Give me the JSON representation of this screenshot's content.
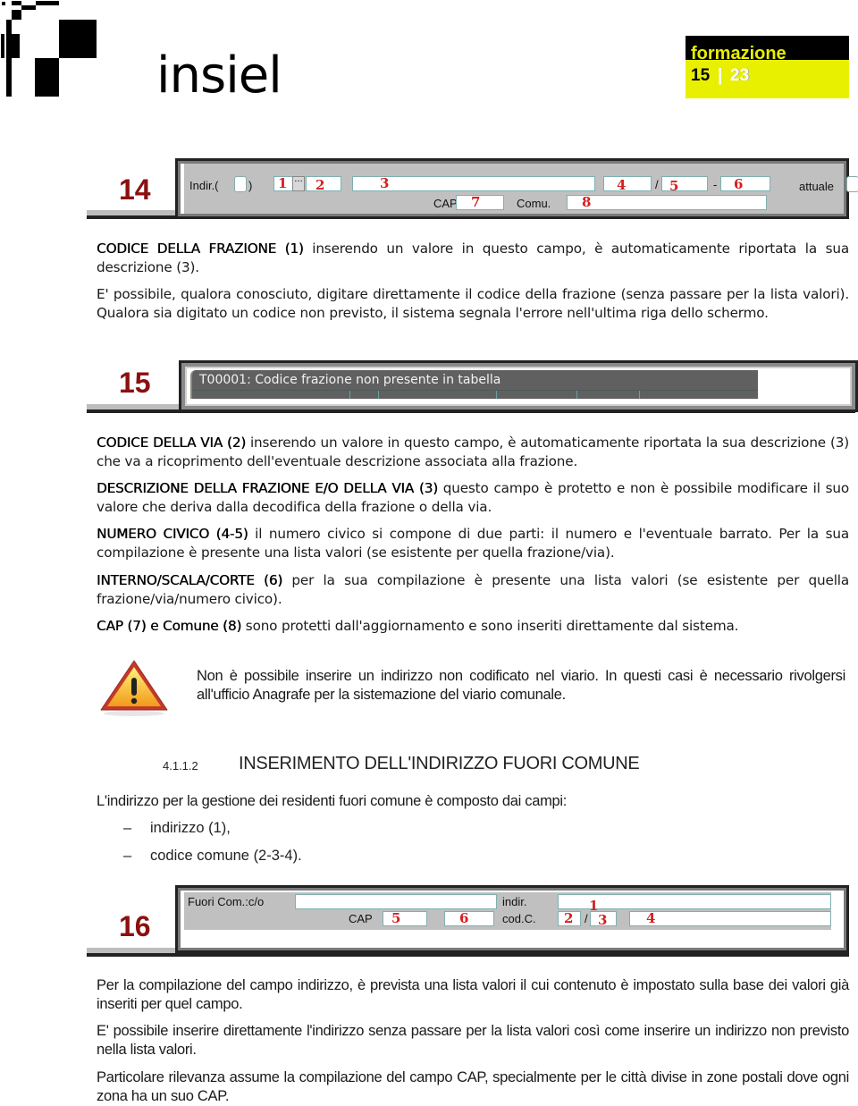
{
  "header": {
    "brand": "insiel",
    "badge_label": "formazione",
    "page_current": "15",
    "page_separator": "|",
    "page_total": "23",
    "colors": {
      "badge_yellow": "#e8f000",
      "figure_number": "#8b1010",
      "field_number": "#d42020"
    }
  },
  "figure14": {
    "number": "14",
    "labels": {
      "indir": "Indir.(",
      "close_paren": ")",
      "ellipsis": "···",
      "slash": "/",
      "dash": "-",
      "attuale": "attuale",
      "cap": "CAP",
      "comu": "Comu."
    },
    "field_numbers": [
      "1",
      "2",
      "3",
      "4",
      "5",
      "6",
      "7",
      "8"
    ]
  },
  "paragraphs_a": {
    "p1_bold": "CODICE DELLA FRAZIONE (1)",
    "p1_text": " inserendo un valore in questo campo, è automaticamente riportata la sua descrizione (3).",
    "p2_text": "E' possibile, qualora conosciuto, digitare direttamente il codice della frazione (senza passare per la lista valori). Qualora sia digitato un codice non previsto, il sistema segnala l'errore nell'ultima riga dello schermo."
  },
  "figure15": {
    "number": "15",
    "error_message": "T00001: Codice frazione non presente in tabella"
  },
  "paragraphs_b": [
    {
      "bold": "CODICE DELLA VIA (2)",
      "text": " inserendo un valore in questo campo, è automaticamente riportata la sua descrizione (3) che va a ricoprimento dell'eventuale descrizione associata alla frazione."
    },
    {
      "bold": "DESCRIZIONE DELLA FRAZIONE E/O DELLA VIA (3)",
      "text": " questo campo è protetto e non è possibile modificare il suo valore che deriva dalla decodifica della frazione o della via."
    },
    {
      "bold": "NUMERO CIVICO (4-5)",
      "text": " il numero civico si compone di due parti: il numero e l'eventuale barrato. Per la sua compilazione è presente una lista valori (se esistente per quella frazione/via)."
    },
    {
      "bold": "INTERNO/SCALA/CORTE (6)",
      "text": " per la sua compilazione è presente una lista valori (se esistente per quella frazione/via/numero civico)."
    },
    {
      "bold": "CAP (7) e Comune (8)",
      "text": " sono protetti dall'aggiornamento e sono inseriti direttamente dal sistema."
    }
  ],
  "warning": {
    "icon": "warning-icon",
    "text": "Non è possibile inserire un indirizzo non codificato nel viario. In questi casi è necessario rivolgersi all'ufficio Anagrafe per la sistemazione del viario comunale."
  },
  "section": {
    "number": "4.1.1.2",
    "title": "INSERIMENTO DELL'INDIRIZZO FUORI COMUNE",
    "intro": "L'indirizzo per la gestione dei residenti fuori comune è composto dai campi:",
    "bullets": [
      "indirizzo (1),",
      "codice comune (2-3-4)."
    ],
    "bullet_marker": "–"
  },
  "figure16": {
    "number": "16",
    "labels": {
      "fuori_com": "Fuori Com.:c/o",
      "cap": "CAP",
      "indir": "indir.",
      "codc": "cod.C.",
      "slash": "/"
    },
    "field_numbers": [
      "1",
      "2",
      "3",
      "4",
      "5",
      "6"
    ]
  },
  "paragraphs_c": [
    "Per la compilazione del campo indirizzo, è prevista una lista valori il cui contenuto è impostato sulla base dei valori già inseriti per quel campo.",
    "E' possibile inserire direttamente l'indirizzo senza passare per la lista valori così come inserire un indirizzo non previsto nella lista valori.",
    "Particolare rilevanza assume la compilazione del campo CAP, specialmente per le città divise in zone postali dove ogni zona ha un suo CAP."
  ]
}
